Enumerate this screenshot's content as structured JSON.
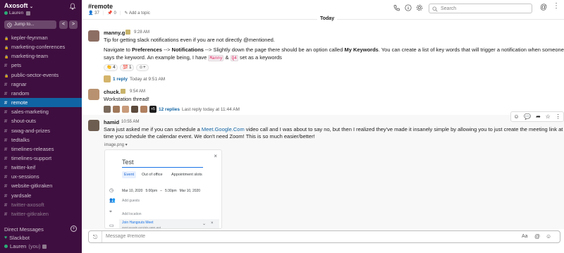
{
  "workspace": {
    "name": "Axosoft",
    "user": "Lauren",
    "jump_label": "Jump to...",
    "back": "<",
    "forward": ">"
  },
  "channels": [
    {
      "name": "kepler-feynman",
      "prefix": "🔒"
    },
    {
      "name": "marketing-conferences",
      "prefix": "🔒"
    },
    {
      "name": "marketing-team",
      "prefix": "🔒"
    },
    {
      "name": "pets",
      "prefix": "#"
    },
    {
      "name": "public-sector-events",
      "prefix": "🔒"
    },
    {
      "name": "ragnar",
      "prefix": "#"
    },
    {
      "name": "random",
      "prefix": "#"
    },
    {
      "name": "remote",
      "prefix": "#",
      "active": true
    },
    {
      "name": "sales-marketing",
      "prefix": "#"
    },
    {
      "name": "shout-outs",
      "prefix": "#"
    },
    {
      "name": "swag-and-prizes",
      "prefix": "#"
    },
    {
      "name": "tedtalks",
      "prefix": "#"
    },
    {
      "name": "timelines-releases",
      "prefix": "#"
    },
    {
      "name": "timelines-support",
      "prefix": "#"
    },
    {
      "name": "twitter-keif",
      "prefix": "#"
    },
    {
      "name": "ux-sessions",
      "prefix": "#"
    },
    {
      "name": "website-gitkraken",
      "prefix": "#"
    },
    {
      "name": "yardsale",
      "prefix": "#"
    },
    {
      "name": "twitter-axosoft",
      "prefix": "#",
      "muted": true
    },
    {
      "name": "twitter-gitkraken",
      "prefix": "#",
      "muted": true
    }
  ],
  "dm": {
    "header": "Direct Messages",
    "items": [
      {
        "name": "Slackbot"
      },
      {
        "name": "Lauren",
        "suffix": "(you)"
      }
    ]
  },
  "header": {
    "title": "#remote",
    "members": "37",
    "pinned": "0",
    "add_topic": "Add a topic",
    "search_placeholder": "Search"
  },
  "day_divider": "Today",
  "messages": [
    {
      "author": "manny.g",
      "time": "9:28 AM",
      "line1": "Tip for getting slack notifications even if you are not directly @mentioned.",
      "line2_a": "Navigate to ",
      "line2_b": "Preferences",
      "line2_c": " --> ",
      "line2_d": "Notifications",
      "line2_e": " --> Slightly down the page there should be an option called ",
      "line2_f": "My Keywords",
      "line2_g": ". You can create a list of key words that will trigger a notification when someone",
      "line3_a": "says the keyword. An example being, I have ",
      "code1": "Manny",
      "line3_b": " & ",
      "code2": "Q4",
      "line3_c": " set as a keywords",
      "reactions": [
        "👏 4",
        "💯 1",
        "☺+"
      ],
      "reply_link": "1 reply",
      "reply_meta": "Today at 9:51 AM"
    },
    {
      "author": "chuck.",
      "time": "9:54 AM",
      "text": "Workstation thread!",
      "reply_more": "+5",
      "reply_link": "12 replies",
      "reply_meta": "Last reply today at 11:44 AM"
    },
    {
      "author": "hamid",
      "time": "10:55 AM",
      "line1_a": "Sara just asked me if you can schedule a ",
      "line1_link": "Meet.Google.Com",
      "line1_b": " video call and I was about to say no, but then I realized they've made it insanely simple by allowing you to just create the meeting link at the",
      "line2": "time you schedule the calendar event. We don't need Zoom! This is so much easier/better!",
      "image_label": "image.png ▾"
    }
  ],
  "gcal": {
    "title": "Test",
    "tab_event": "Event",
    "tab_ooo": "Out of office",
    "tab_appt": "Appointment slots",
    "date1": "Mar 10, 2020",
    "time1": "5:00pm",
    "dash": "–",
    "time2": "5:30pm",
    "date2": "Mar 10, 2020",
    "add_guests": "Add guests",
    "add_location": "Add location",
    "meet": "Join Hangouts Meet",
    "meet_url": "meet.google.com/gjn-pane-acd"
  },
  "composer": {
    "placeholder": "Message #remote",
    "format": "Aa"
  },
  "colors": {
    "sidebar": "#3f0e40",
    "active": "#1164a3",
    "link": "#1264a3"
  }
}
